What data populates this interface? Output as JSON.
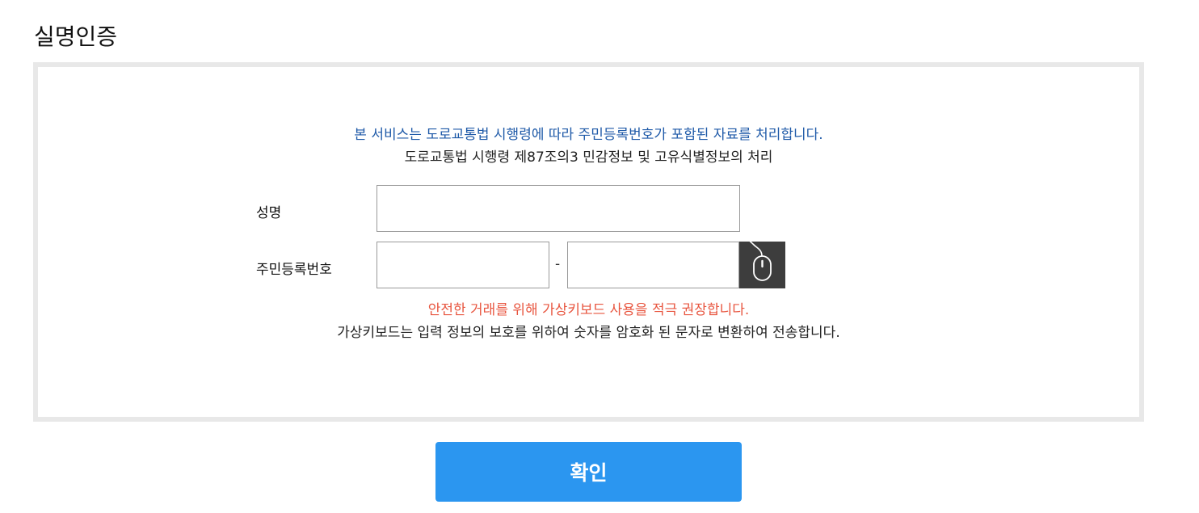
{
  "page": {
    "title": "실명인증"
  },
  "notice": {
    "line1": "본 서비스는 도로교통법 시행령에 따라 주민등록번호가 포함된 자료를 처리합니다.",
    "line2": "도로교통법 시행령 제87조의3 민감정보 및 고유식별정보의 처리"
  },
  "form": {
    "name_label": "성명",
    "name_value": "",
    "rrn_label": "주민등록번호",
    "rrn_front_value": "",
    "rrn_separator": "-",
    "rrn_back_value": "",
    "keypad_icon": "mouse-icon"
  },
  "warning": {
    "line1": "안전한 거래를 위해 가상키보드 사용을 적극 권장합니다.",
    "line2": "가상키보드는 입력 정보의 보호를 위하여 숫자를 암호화 된 문자로 변환하여 전송합니다."
  },
  "actions": {
    "confirm_label": "확인"
  },
  "colors": {
    "notice_blue": "#1f5aa8",
    "warning_red": "#e8553f",
    "button_blue": "#2b96f0",
    "panel_border": "#e8e8e8",
    "keypad_bg": "#3d3d3d"
  }
}
